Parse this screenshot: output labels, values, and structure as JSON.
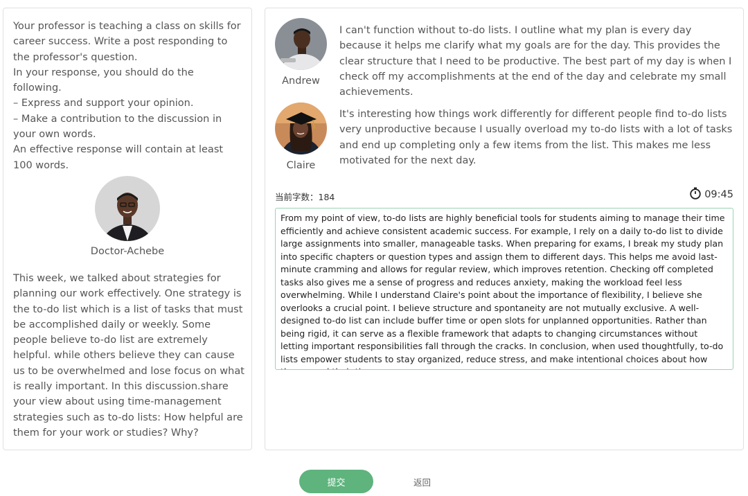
{
  "task": {
    "prompt_lines": [
      "Your professor is teaching a class on skills for career success. Write a post responding to the professor's question.",
      "In your response, you should do the following.",
      "– Express and support your opinion.",
      "– Make a contribution to the discussion in your own words.",
      "An effective response will contain at least 100 words."
    ]
  },
  "professor": {
    "name": "Doctor-Achebe",
    "text": "This week, we talked about strategies for planning our work effectively. One strategy is the to-do list which is a list of tasks that must be accomplished daily or weekly. Some people believe to-do list are extremely helpful. while others believe they can cause us to be overwhelmed and lose focus on what is really important. In this discussion.share your view about using time-management strategies such as to-do lists: How helpful are them for your work or studies? Why?"
  },
  "students": [
    {
      "name": "Andrew",
      "text": "I can't function without to-do lists. I outline what my plan is every day because it helps me clarify what my goals are for the day. This provides the clear structure that I need to be productive. The best part of my day is when I check off my accomplishments at the end of the day and celebrate my small achievements."
    },
    {
      "name": "Claire",
      "text": "It's interesting how things work differently for different people find to-do lists very unproductive because I usually overload my to-do lists with a lot of tasks and end up completing only a few items from the list. This makes me less motivated for the next day."
    }
  ],
  "editor": {
    "word_count_label": "当前字数：184",
    "timer": "09:45",
    "timer_icon": "stopwatch-icon",
    "answer": "From my point of view, to-do lists are highly beneficial tools for students aiming to manage their time efficiently and achieve consistent academic success. For example, I rely on a daily to-do list to divide large assignments into smaller, manageable tasks. When preparing for exams, I break my study plan into specific chapters or question types and assign them to different days. This helps me avoid last-minute cramming and allows for regular review, which improves retention. Checking off completed tasks also gives me a sense of progress and reduces anxiety, making the workload feel less overwhelming. While I understand Claire's point about the importance of flexibility, I believe she overlooks a crucial point. I believe structure and spontaneity are not mutually exclusive. A well-designed to-do list can include buffer time or open slots for unplanned opportunities. Rather than being rigid, it can serve as a flexible framework that adapts to changing circumstances without letting important responsibilities fall through the cracks. In conclusion, when used thoughtfully, to-do lists empower students to stay organized, reduce stress, and make intentional choices about how they spend their time."
  },
  "actions": {
    "submit_label": "提交",
    "back_label": "返回"
  },
  "colors": {
    "accent": "#5fb37d",
    "answer_border": "#9ad3b6"
  }
}
